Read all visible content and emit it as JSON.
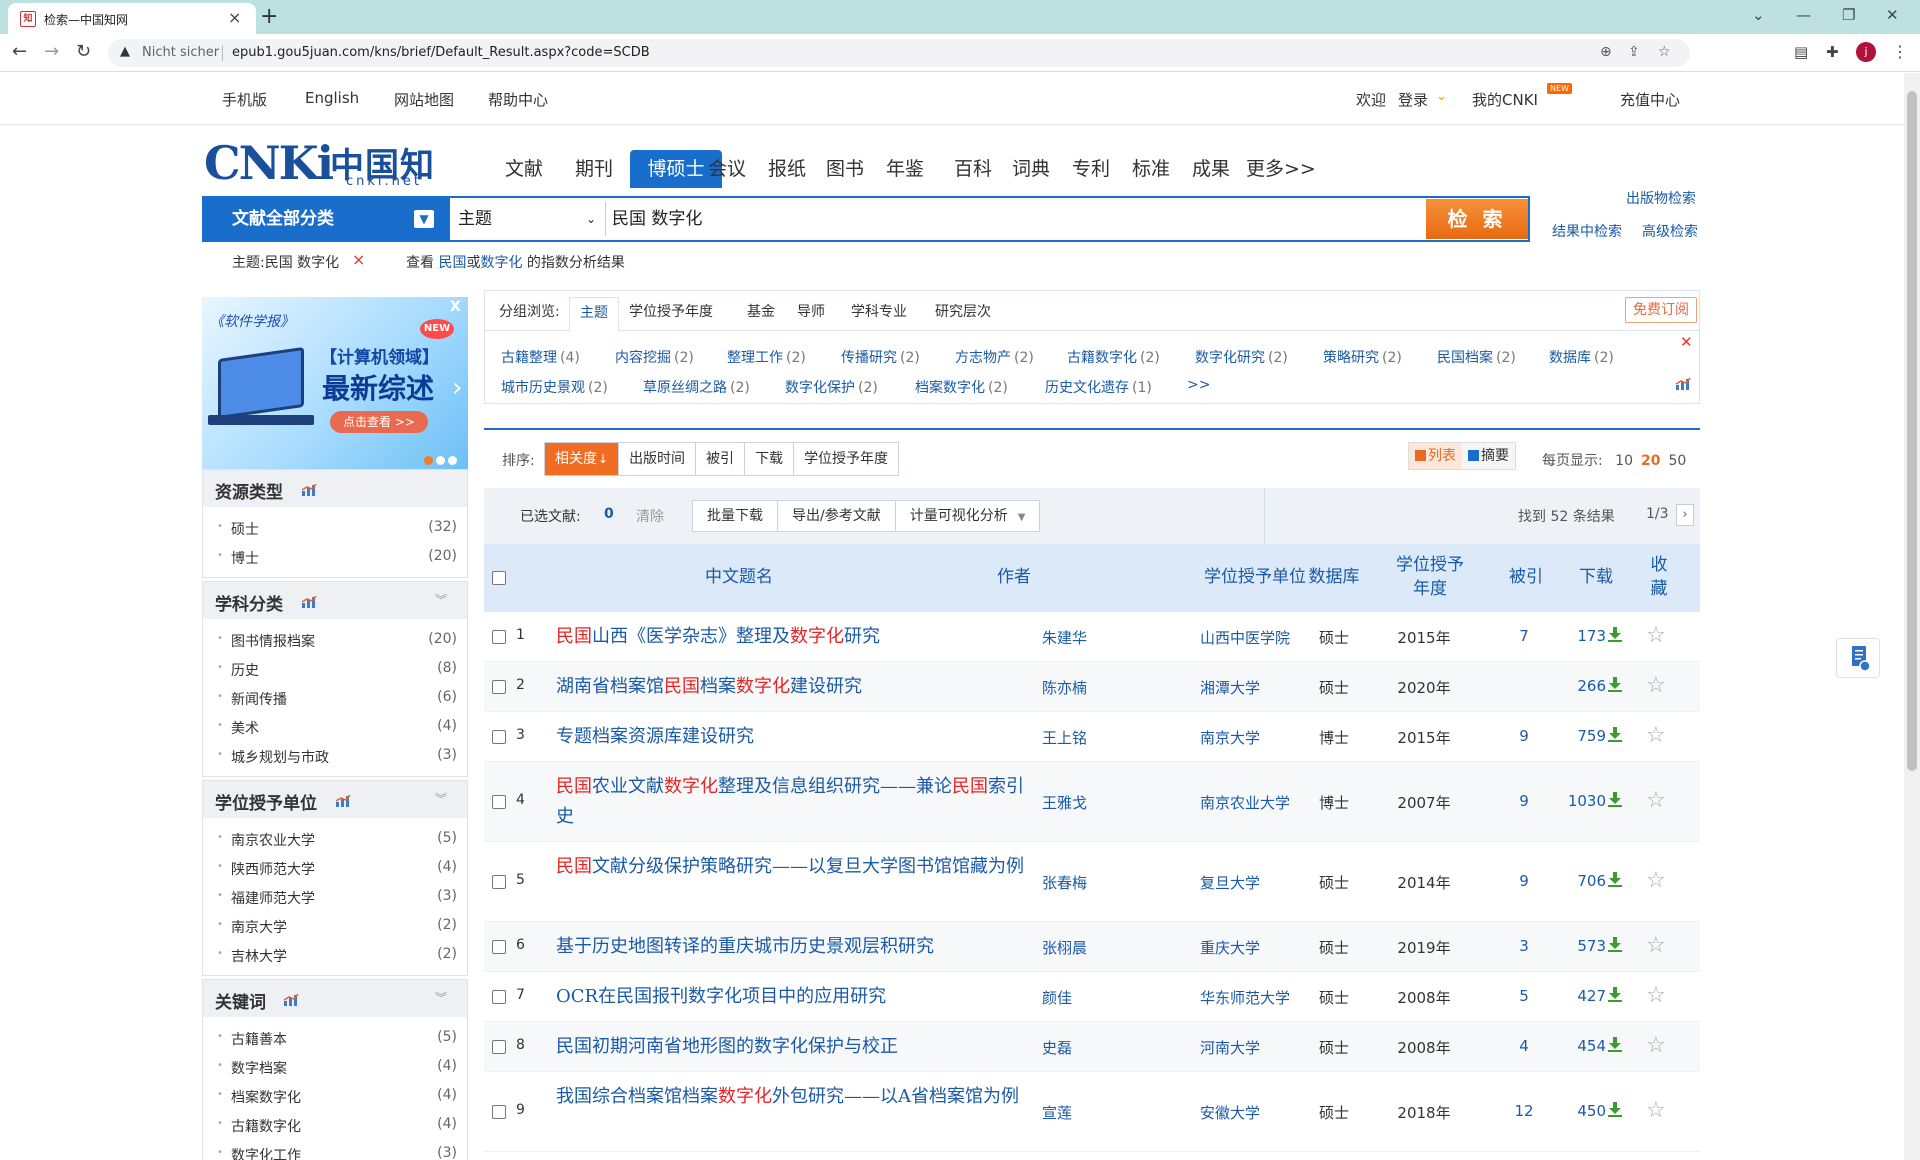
{
  "browser": {
    "tab_title": "检索—中国知网",
    "insecure_label": "Nicht sicher",
    "url": "epub1.gou5juan.com/kns/brief/Default_Result.aspx?code=SCDB"
  },
  "topbar": {
    "mobile": "手机版",
    "english": "English",
    "sitemap": "网站地图",
    "help": "帮助中心",
    "welcome": "欢迎",
    "login": "登录",
    "my_cnki": "我的CNKI",
    "new_badge": "NEW",
    "recharge": "充值中心"
  },
  "logo": {
    "cnki": "CNKi",
    "cn_name": "中国知网",
    "domain": "cnki.net"
  },
  "nav_tabs": [
    "文献",
    "期刊",
    "博硕士",
    "会议",
    "报纸",
    "图书",
    "年鉴",
    "百科",
    "词典",
    "专利",
    "标准",
    "成果",
    "更多>>"
  ],
  "nav_active": "博硕士",
  "search": {
    "category_label": "文献全部分类",
    "field": "主题",
    "query": "民国  数字化",
    "button": "检 索",
    "pub_search": "出版物检索",
    "in_result": "结果中检索",
    "advanced": "高级检索"
  },
  "crumb": {
    "label": "主题:民国 数字化",
    "view_prefix": "查看",
    "term1": "民国",
    "or": "或",
    "term2": "数字化",
    "view_suffix": "的指数分析结果"
  },
  "ad": {
    "tag": "《软件学报》",
    "new": "NEW",
    "line1": "【计算机领域】",
    "line2": "最新综述",
    "button": "点击查看 >>",
    "close": "X"
  },
  "facets": [
    {
      "title": "资源类型",
      "items": [
        {
          "name": "硕士",
          "count": "(32)"
        },
        {
          "name": "博士",
          "count": "(20)"
        }
      ]
    },
    {
      "title": "学科分类",
      "items": [
        {
          "name": "图书情报档案",
          "count": "(20)"
        },
        {
          "name": "历史",
          "count": "(8)"
        },
        {
          "name": "新闻传播",
          "count": "(6)"
        },
        {
          "name": "美术",
          "count": "(4)"
        },
        {
          "name": "城乡规划与市政",
          "count": "(3)"
        }
      ]
    },
    {
      "title": "学位授予单位",
      "items": [
        {
          "name": "南京农业大学",
          "count": "(5)"
        },
        {
          "name": "陕西师范大学",
          "count": "(4)"
        },
        {
          "name": "福建师范大学",
          "count": "(3)"
        },
        {
          "name": "南京大学",
          "count": "(2)"
        },
        {
          "name": "吉林大学",
          "count": "(2)"
        }
      ]
    },
    {
      "title": "关键词",
      "items": [
        {
          "name": "古籍善本",
          "count": "(5)"
        },
        {
          "name": "数字档案",
          "count": "(4)"
        },
        {
          "name": "档案数字化",
          "count": "(4)"
        },
        {
          "name": "古籍数字化",
          "count": "(4)"
        },
        {
          "name": "数字化工作",
          "count": "(3)"
        }
      ]
    }
  ],
  "group": {
    "label": "分组浏览:",
    "tabs": [
      "主题",
      "学位授予年度",
      "基金",
      "导师",
      "学科专业",
      "研究层次"
    ],
    "active": "主题",
    "subscribe": "免费订阅",
    "row1": [
      {
        "name": "古籍整理",
        "count": "(4)"
      },
      {
        "name": "内容挖掘",
        "count": "(2)"
      },
      {
        "name": "整理工作",
        "count": "(2)"
      },
      {
        "name": "传播研究",
        "count": "(2)"
      },
      {
        "name": "方志物产",
        "count": "(2)"
      },
      {
        "name": "古籍数字化",
        "count": "(2)"
      },
      {
        "name": "数字化研究",
        "count": "(2)"
      },
      {
        "name": "策略研究",
        "count": "(2)"
      },
      {
        "name": "民国档案",
        "count": "(2)"
      },
      {
        "name": "数据库",
        "count": "(2)"
      }
    ],
    "row2": [
      {
        "name": "城市历史景观",
        "count": "(2)"
      },
      {
        "name": "草原丝绸之路",
        "count": "(2)"
      },
      {
        "name": "数字化保护",
        "count": "(2)"
      },
      {
        "name": "档案数字化",
        "count": "(2)"
      },
      {
        "name": "历史文化遗存",
        "count": "(1)"
      },
      {
        "name": ">>",
        "count": ""
      }
    ]
  },
  "sort": {
    "label": "排序:",
    "options": [
      "相关度",
      "出版时间",
      "被引",
      "下载",
      "学位授予年度"
    ],
    "active": "相关度",
    "view_list": "列表",
    "view_abstract": "摘要",
    "per_page_label": "每页显示:",
    "per_page": [
      "10",
      "20",
      "50"
    ],
    "per_page_active": "20"
  },
  "selection": {
    "label": "已选文献:",
    "count": "0",
    "clear": "清除",
    "actions": [
      "批量下载",
      "导出/参考文献",
      "计量可视化分析"
    ],
    "found": "找到 52 条结果",
    "page": "1/3"
  },
  "table": {
    "headers": {
      "title": "中文题名",
      "author": "作者",
      "unit": "学位授予单位",
      "db": "数据库",
      "year1": "学位授予",
      "year2": "年度",
      "cite": "被引",
      "download": "下载",
      "fav1": "收",
      "fav2": "藏"
    },
    "rows": [
      {
        "num": "1",
        "title": [
          {
            "t": "民国",
            "hl": true
          },
          {
            "t": "山西《医学杂志》整理及",
            "hl": false
          },
          {
            "t": "数字化",
            "hl": true
          },
          {
            "t": "研究",
            "hl": false
          }
        ],
        "author": "朱建华",
        "unit": "山西中医学院",
        "db": "硕士",
        "year": "2015年",
        "cite": "7",
        "download": "173"
      },
      {
        "num": "2",
        "title": [
          {
            "t": "湖南省档案馆",
            "hl": false
          },
          {
            "t": "民国",
            "hl": true
          },
          {
            "t": "档案",
            "hl": false
          },
          {
            "t": "数字化",
            "hl": true
          },
          {
            "t": "建设研究",
            "hl": false
          }
        ],
        "author": "陈亦楠",
        "unit": "湘潭大学",
        "db": "硕士",
        "year": "2020年",
        "cite": "",
        "download": "266"
      },
      {
        "num": "3",
        "title": [
          {
            "t": "专题档案资源库建设研究",
            "hl": false
          }
        ],
        "author": "王上铭",
        "unit": "南京大学",
        "db": "博士",
        "year": "2015年",
        "cite": "9",
        "download": "759"
      },
      {
        "num": "4",
        "title": [
          {
            "t": "民国",
            "hl": true
          },
          {
            "t": "农业文献",
            "hl": false
          },
          {
            "t": "数字化",
            "hl": true
          },
          {
            "t": "整理及信息组织研究——兼论",
            "hl": false
          },
          {
            "t": "民国",
            "hl": true
          },
          {
            "t": "索引史",
            "hl": false
          }
        ],
        "author": "王雅戈",
        "unit": "南京农业大学",
        "db": "博士",
        "year": "2007年",
        "cite": "9",
        "download": "1030"
      },
      {
        "num": "5",
        "title": [
          {
            "t": "民国",
            "hl": true
          },
          {
            "t": "文献分级保护策略研究——以复旦大学图书馆馆藏为例",
            "hl": false
          }
        ],
        "author": "张春梅",
        "unit": "复旦大学",
        "db": "硕士",
        "year": "2014年",
        "cite": "9",
        "download": "706"
      },
      {
        "num": "6",
        "title": [
          {
            "t": "基于历史地图转译的重庆城市历史景观层积研究",
            "hl": false
          }
        ],
        "author": "张栩晨",
        "unit": "重庆大学",
        "db": "硕士",
        "year": "2019年",
        "cite": "3",
        "download": "573"
      },
      {
        "num": "7",
        "title": [
          {
            "t": "OCR在民国报刊数字化项目中的应用研究",
            "hl": false
          }
        ],
        "author": "颜佳",
        "unit": "华东师范大学",
        "db": "硕士",
        "year": "2008年",
        "cite": "5",
        "download": "427"
      },
      {
        "num": "8",
        "title": [
          {
            "t": "民国初期河南省地形图的数字化保护与校正",
            "hl": false
          }
        ],
        "author": "史磊",
        "unit": "河南大学",
        "db": "硕士",
        "year": "2008年",
        "cite": "4",
        "download": "454"
      },
      {
        "num": "9",
        "title": [
          {
            "t": "我国综合档案馆档案",
            "hl": false
          },
          {
            "t": "数字化",
            "hl": true
          },
          {
            "t": "外包研究——以A省档案馆为例",
            "hl": false
          }
        ],
        "author": "宣莲",
        "unit": "安徽大学",
        "db": "硕士",
        "year": "2018年",
        "cite": "12",
        "download": "450"
      }
    ]
  },
  "colors": {
    "primary_blue": "#1a6ecb",
    "accent_orange": "#f06d23",
    "highlight_red": "#e62424",
    "link_blue": "#1a5aa6"
  }
}
